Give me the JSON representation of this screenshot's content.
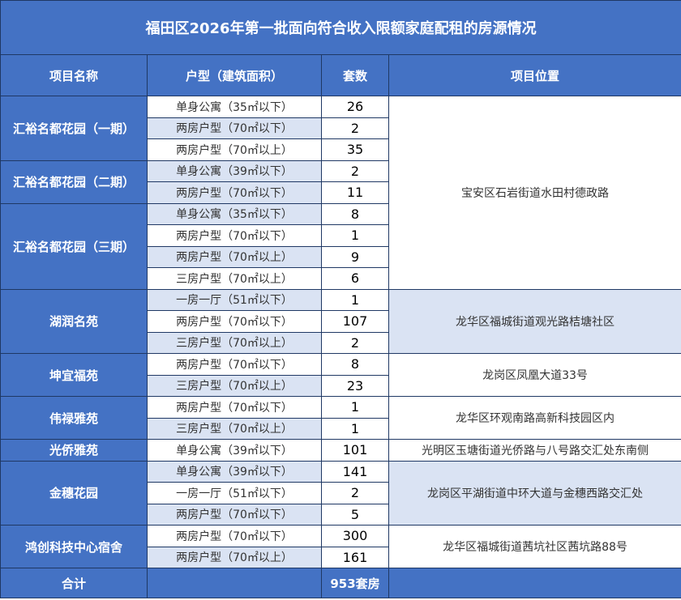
{
  "title": "福田区2026年第一批面向符合收入限额家庭配租的房源情况",
  "headers": {
    "name": "项目名称",
    "type": "户型（建筑面积）",
    "count": "套数",
    "location": "项目位置"
  },
  "projects": [
    {
      "name": "汇裕名都花园（一期）",
      "units": [
        {
          "type": "单身公寓（35㎡以下）",
          "count": "26"
        },
        {
          "type": "两房户型（70㎡以下）",
          "count": "2"
        },
        {
          "type": "两房户型（70㎡以上）",
          "count": "35"
        }
      ]
    },
    {
      "name": "汇裕名都花园（二期）",
      "units": [
        {
          "type": "单身公寓（39㎡以下）",
          "count": "2"
        },
        {
          "type": "两房户型（70㎡以下）",
          "count": "11"
        }
      ]
    },
    {
      "name": "汇裕名都花园（三期）",
      "units": [
        {
          "type": "单身公寓（35㎡以下）",
          "count": "8"
        },
        {
          "type": "两房户型（70㎡以下）",
          "count": "1"
        },
        {
          "type": "两房户型（70㎡以上）",
          "count": "9"
        },
        {
          "type": "三房户型（70㎡以上）",
          "count": "6"
        }
      ]
    },
    {
      "name": "湖润名苑",
      "units": [
        {
          "type": "一房一厅（51㎡以下）",
          "count": "1"
        },
        {
          "type": "两房户型（70㎡以下）",
          "count": "107"
        },
        {
          "type": "三房户型（70㎡以上）",
          "count": "2"
        }
      ]
    },
    {
      "name": "坤宜福苑",
      "units": [
        {
          "type": "两房户型（70㎡以下）",
          "count": "8"
        },
        {
          "type": "三房户型（70㎡以上）",
          "count": "23"
        }
      ]
    },
    {
      "name": "伟禄雅苑",
      "units": [
        {
          "type": "两房户型（70㎡以下）",
          "count": "1"
        },
        {
          "type": "三房户型（70㎡以上）",
          "count": "1"
        }
      ]
    },
    {
      "name": "光侨雅苑",
      "units": [
        {
          "type": "单身公寓（39㎡以下）",
          "count": "101"
        }
      ]
    },
    {
      "name": "金穗花园",
      "units": [
        {
          "type": "单身公寓（39㎡以下）",
          "count": "141"
        },
        {
          "type": "一房一厅（51㎡以下）",
          "count": "2"
        },
        {
          "type": "两房户型（70㎡以下）",
          "count": "5"
        }
      ]
    },
    {
      "name": "鸿创科技中心宿舍",
      "units": [
        {
          "type": "两房户型（70㎡以下）",
          "count": "300"
        },
        {
          "type": "两房户型（70㎡以上）",
          "count": "161"
        }
      ]
    }
  ],
  "locations": {
    "huiyu": "宝安区石岩街道水田村德政路",
    "hurun": "龙华区福城街道观光路桔塘社区",
    "kunyi": "龙岗区凤凰大道33号",
    "weilu": "龙华区环观南路高新科技园区内",
    "guangqiao": "光明区玉塘街道光侨路与八号路交汇处东南侧",
    "jinsui": "龙岗区平湖街道中环大道与金穗西路交汇处",
    "hongchuang": "龙华区福城街道茜坑社区茜坑路88号"
  },
  "total": {
    "label": "合计",
    "value": "953套房"
  },
  "colors": {
    "header_blue": "#4472c4",
    "row_light_blue": "#dae3f3",
    "border": "#1f3864"
  }
}
